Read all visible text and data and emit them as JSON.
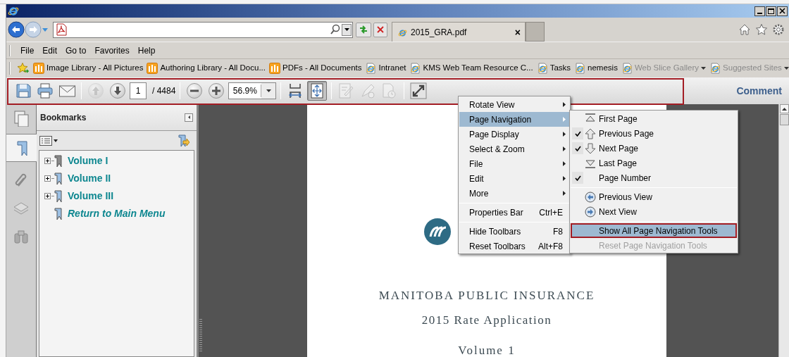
{
  "browser": {
    "tab": {
      "title": "2015_GRA.pdf",
      "close": "×"
    }
  },
  "menu_bar": [
    "File",
    "Edit",
    "Go to",
    "Favorites",
    "Help"
  ],
  "favorites_bar": [
    {
      "label": "Image Library - All Pictures",
      "kind": "sharepoint",
      "dimmed": false,
      "has_menu": false
    },
    {
      "label": "Authoring Library - All Docu...",
      "kind": "sharepoint",
      "dimmed": false,
      "has_menu": false
    },
    {
      "label": "PDFs - All Documents",
      "kind": "sharepoint",
      "dimmed": false,
      "has_menu": false
    },
    {
      "label": "Intranet",
      "kind": "page",
      "dimmed": false,
      "has_menu": false
    },
    {
      "label": "KMS Web Team Resource C...",
      "kind": "page",
      "dimmed": false,
      "has_menu": false
    },
    {
      "label": "Tasks",
      "kind": "page",
      "dimmed": false,
      "has_menu": false
    },
    {
      "label": "nemesis",
      "kind": "page",
      "dimmed": false,
      "has_menu": false
    },
    {
      "label": "Web Slice Gallery",
      "kind": "page",
      "dimmed": true,
      "has_menu": true
    },
    {
      "label": "Suggested Sites",
      "kind": "page",
      "dimmed": true,
      "has_menu": true
    }
  ],
  "pdf_toolbar": {
    "outlined": true,
    "tools": [
      {
        "kind": "save",
        "disabled": false,
        "selected": false
      },
      {
        "kind": "print",
        "disabled": false,
        "selected": false
      },
      {
        "kind": "email",
        "disabled": false,
        "selected": false
      },
      {
        "kind": "separator"
      },
      {
        "kind": "previous_page",
        "disabled": true,
        "selected": false
      },
      {
        "kind": "next_page",
        "disabled": false,
        "selected": false
      },
      {
        "kind": "page_field",
        "value": "1",
        "total": "/ 4484"
      },
      {
        "kind": "separator"
      },
      {
        "kind": "zoom_out",
        "disabled": false,
        "selected": false
      },
      {
        "kind": "zoom_in",
        "disabled": false,
        "selected": false
      },
      {
        "kind": "zoom_field",
        "value": "56.9%"
      },
      {
        "kind": "separator"
      },
      {
        "kind": "fit_width",
        "disabled": false,
        "selected": false
      },
      {
        "kind": "fit_page",
        "disabled": false,
        "selected": true
      },
      {
        "kind": "separator"
      },
      {
        "kind": "sign",
        "disabled": true,
        "selected": false
      },
      {
        "kind": "pen",
        "disabled": true,
        "selected": false
      },
      {
        "kind": "clock",
        "disabled": true,
        "selected": false
      },
      {
        "kind": "separator"
      },
      {
        "kind": "full_screen",
        "disabled": false,
        "selected": false
      }
    ],
    "comment": "Comment"
  },
  "navigation_panel": {
    "tabs": [
      {
        "kind": "pages",
        "selected": false
      },
      {
        "kind": "bookmarks",
        "selected": true
      },
      {
        "kind": "attachments",
        "selected": false
      },
      {
        "kind": "layers",
        "selected": false
      },
      {
        "kind": "search",
        "selected": false
      }
    ],
    "title": "Bookmarks",
    "bookmarks": [
      {
        "label": "Volume I",
        "kind": "folder",
        "expanded": false,
        "selected": true
      },
      {
        "label": "Volume II",
        "kind": "folder",
        "expanded": false,
        "selected": false
      },
      {
        "label": "Volume III",
        "kind": "folder",
        "expanded": false,
        "selected": false
      },
      {
        "label": "Return to Main Menu",
        "kind": "link",
        "selected": false
      }
    ]
  },
  "document": {
    "heading": "MANITOBA PUBLIC INSURANCE",
    "subtitle": "2015 Rate Application",
    "volume": "Volume 1"
  },
  "context_menu": {
    "items": [
      {
        "kind": "item",
        "label": "Rotate View",
        "has_submenu": true,
        "selected": false
      },
      {
        "kind": "item",
        "label": "Page Navigation",
        "has_submenu": true,
        "selected": true
      },
      {
        "kind": "item",
        "label": "Page Display",
        "has_submenu": true,
        "selected": false
      },
      {
        "kind": "item",
        "label": "Select & Zoom",
        "has_submenu": true,
        "selected": false
      },
      {
        "kind": "item",
        "label": "File",
        "has_submenu": true,
        "selected": false
      },
      {
        "kind": "item",
        "label": "Edit",
        "has_submenu": true,
        "selected": false
      },
      {
        "kind": "item",
        "label": "More",
        "has_submenu": true,
        "selected": false
      },
      {
        "kind": "separator"
      },
      {
        "kind": "item",
        "label": "Properties Bar",
        "shortcut": "Ctrl+E",
        "has_submenu": false,
        "selected": false
      },
      {
        "kind": "separator"
      },
      {
        "kind": "item",
        "label": "Hide Toolbars",
        "shortcut": "F8",
        "has_submenu": false,
        "selected": false
      },
      {
        "kind": "item",
        "label": "Reset Toolbars",
        "shortcut": "Alt+F8",
        "has_submenu": false,
        "selected": false
      }
    ]
  },
  "submenu": {
    "items": [
      {
        "kind": "first_page",
        "label": "First Page",
        "checked": false,
        "selected": false,
        "disabled": false,
        "outlined": false
      },
      {
        "kind": "previous_page",
        "label": "Previous Page",
        "checked": true,
        "selected": false,
        "disabled": false,
        "outlined": false
      },
      {
        "kind": "next_page",
        "label": "Next Page",
        "checked": true,
        "selected": false,
        "disabled": false,
        "outlined": false
      },
      {
        "kind": "last_page",
        "label": "Last Page",
        "checked": false,
        "selected": false,
        "disabled": false,
        "outlined": false
      },
      {
        "kind": "plain",
        "label": "Page Number",
        "checked": true,
        "selected": false,
        "disabled": false,
        "outlined": false
      },
      {
        "kind": "separator"
      },
      {
        "kind": "previous_view",
        "label": "Previous View",
        "checked": false,
        "selected": false,
        "disabled": false,
        "outlined": false
      },
      {
        "kind": "next_view",
        "label": "Next View",
        "checked": false,
        "selected": false,
        "disabled": false,
        "outlined": false
      },
      {
        "kind": "separator"
      },
      {
        "kind": "plain",
        "label": "Show All Page Navigation Tools",
        "checked": false,
        "selected": true,
        "disabled": false,
        "outlined": true
      },
      {
        "kind": "plain",
        "label": "Reset Page Navigation Tools",
        "checked": false,
        "selected": false,
        "disabled": true,
        "outlined": false
      }
    ]
  }
}
